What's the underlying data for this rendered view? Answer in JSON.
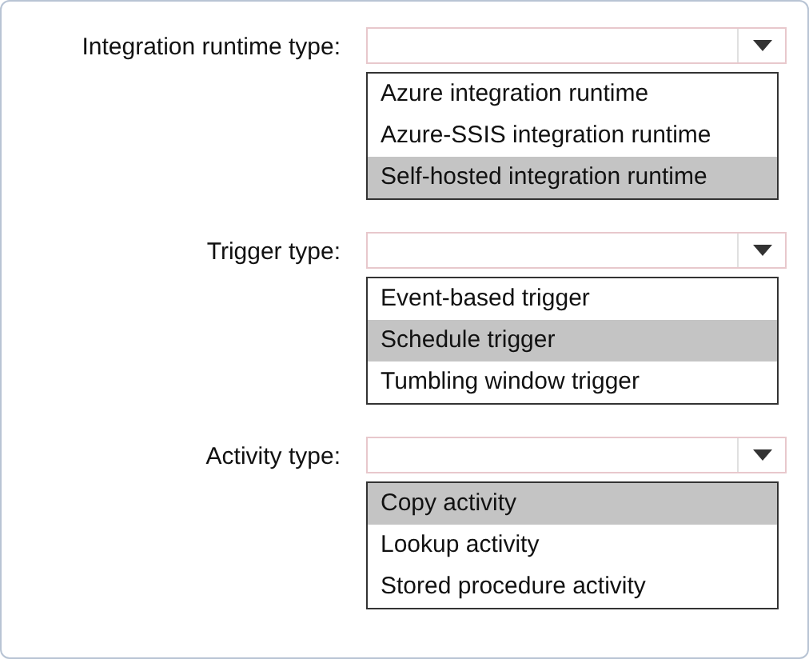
{
  "fields": [
    {
      "label": "Integration runtime type:",
      "options": [
        {
          "text": "Azure integration runtime",
          "selected": false
        },
        {
          "text": "Azure-SSIS integration runtime",
          "selected": false
        },
        {
          "text": "Self-hosted integration runtime",
          "selected": true
        }
      ]
    },
    {
      "label": "Trigger type:",
      "options": [
        {
          "text": "Event-based trigger",
          "selected": false
        },
        {
          "text": "Schedule trigger",
          "selected": true
        },
        {
          "text": "Tumbling window trigger",
          "selected": false
        }
      ]
    },
    {
      "label": "Activity type:",
      "options": [
        {
          "text": "Copy activity",
          "selected": true
        },
        {
          "text": "Lookup activity",
          "selected": false
        },
        {
          "text": "Stored procedure activity",
          "selected": false
        }
      ]
    }
  ]
}
